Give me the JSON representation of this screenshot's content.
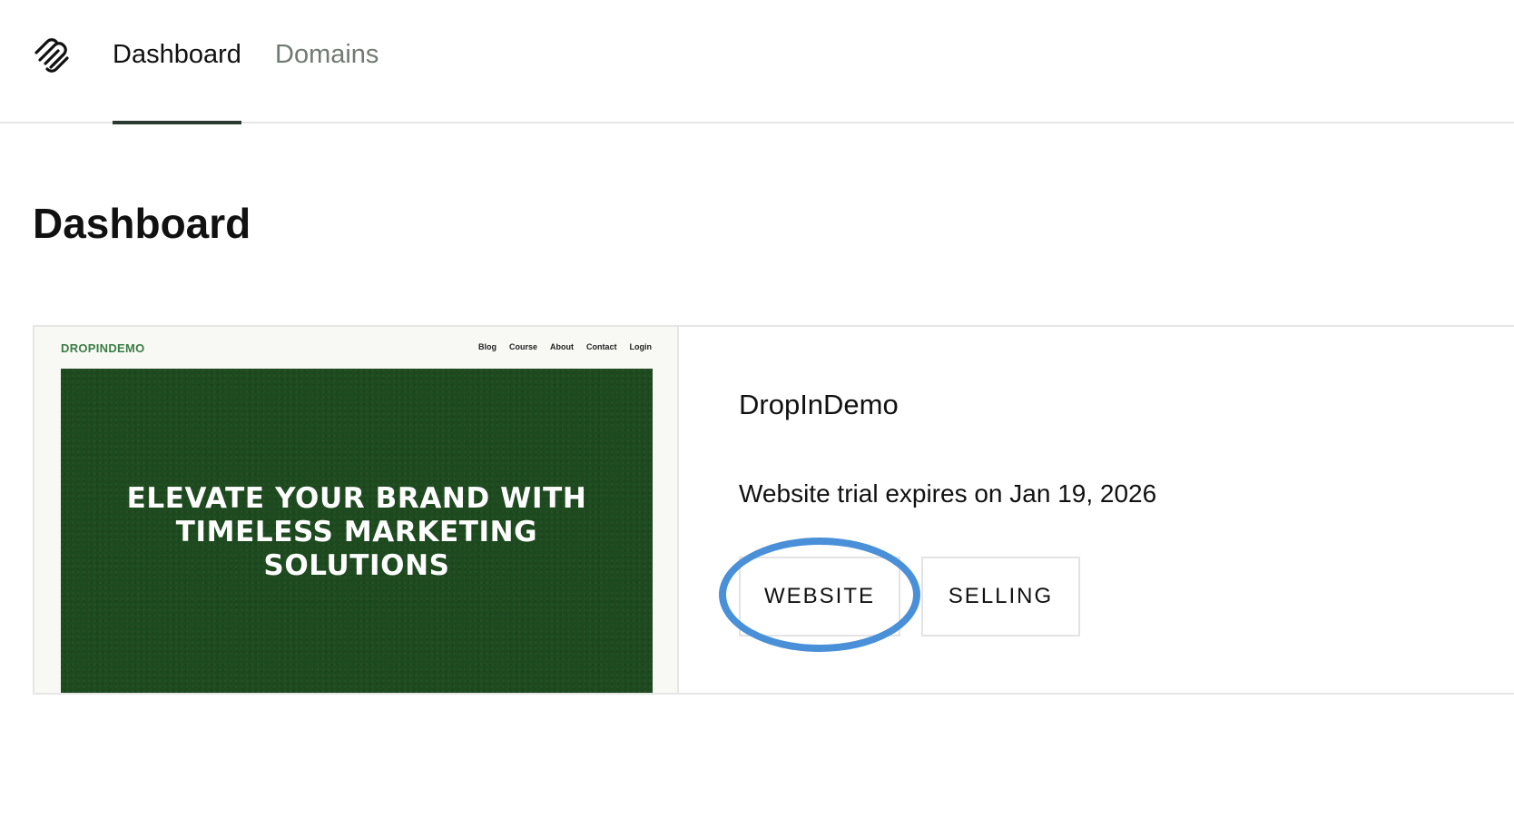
{
  "topbar": {
    "logo_icon": "squarespace-logo-icon",
    "tabs": [
      {
        "label": "Dashboard",
        "active": true
      },
      {
        "label": "Domains",
        "active": false
      }
    ],
    "active_underline_color": "#2b3a31"
  },
  "page": {
    "title": "Dashboard"
  },
  "site_card": {
    "site_name": "DropInDemo",
    "trial_text": "Website trial expires on Jan 19, 2026",
    "buttons": {
      "website_label": "WEBSITE",
      "selling_label": "SELLING"
    },
    "highlight_color": "#4a90d9",
    "thumbnail": {
      "brand": "DROPINDEMO",
      "nav": [
        "Blog",
        "Course",
        "About",
        "Contact",
        "Login"
      ],
      "headline": "ELEVATE YOUR BRAND WITH TIMELESS MARKETING SOLUTIONS",
      "hero_color": "#1e4a1f",
      "brand_color": "#3b7d45"
    }
  }
}
